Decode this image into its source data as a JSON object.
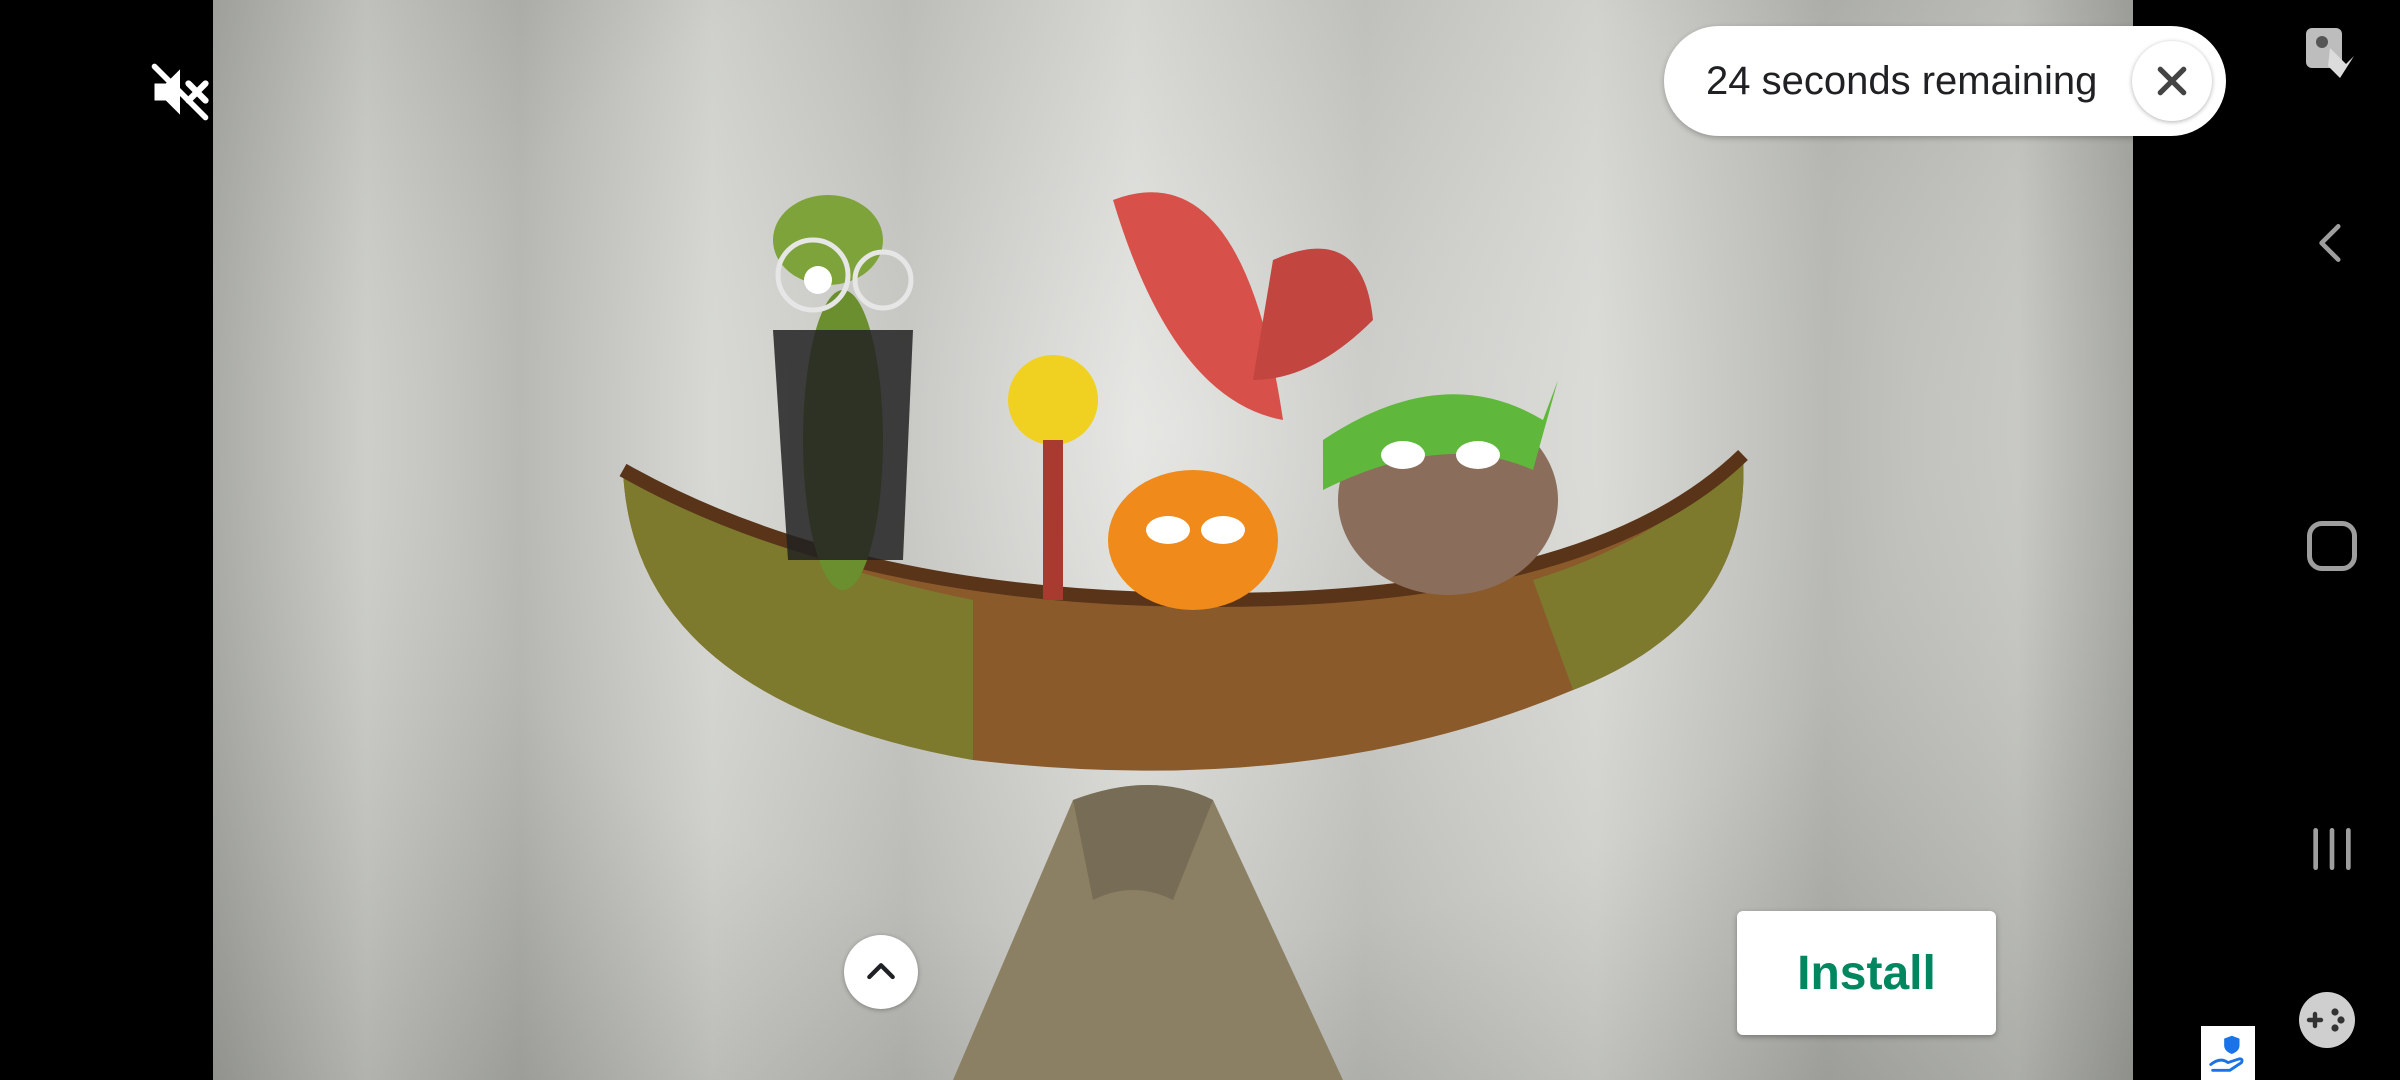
{
  "ad": {
    "countdown_text": "24 seconds remaining",
    "install_label": "Install",
    "accent_color": "#01875f"
  },
  "icons": {
    "mute": "volume-off-icon",
    "close": "close-icon",
    "expand": "chevron-up-icon",
    "lock_touch": "touch-lock-icon",
    "back": "back-icon",
    "home": "home-icon",
    "recents": "recents-icon",
    "game_tools": "game-controller-icon",
    "privacy": "ad-choices-icon"
  }
}
